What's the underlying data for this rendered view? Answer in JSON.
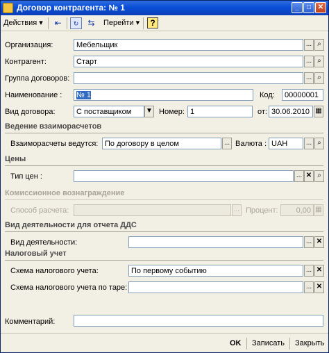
{
  "window": {
    "title": "Договор контрагента: № 1",
    "min": "_",
    "max": "□",
    "close": "✕"
  },
  "toolbar": {
    "actions_label": "Действия",
    "goto_label": "Перейти",
    "help_label": "?"
  },
  "form": {
    "org_label": "Организация:",
    "org_value": "Мебельщик",
    "counterparty_label": "Контрагент:",
    "counterparty_value": "Старт",
    "group_label": "Группа договоров:",
    "group_value": "",
    "name_label": "Наименование :",
    "name_value": "№ 1",
    "code_label": "Код:",
    "code_value": "00000001",
    "type_label": "Вид договора:",
    "type_value": "С поставщиком",
    "number_label": "Номер:",
    "number_value": "1",
    "from_label": "от:",
    "from_value": "30.06.2010"
  },
  "settlements": {
    "section_title": "Ведение взаиморасчетов",
    "mode_label": "Взаиморасчеты ведутся:",
    "mode_value": "По договору в целом",
    "currency_label": "Валюта :",
    "currency_value": "UAH"
  },
  "prices": {
    "section_title": "Цены",
    "type_label": "Тип цен :",
    "type_value": ""
  },
  "commission": {
    "section_title": "Комиссионное вознаграждение",
    "method_label": "Способ расчета:",
    "method_value": "",
    "percent_label": "Процент:",
    "percent_value": "0,00"
  },
  "dds": {
    "section_title": "Вид деятельности для отчета ДДС",
    "activity_label": "Вид деятельности:",
    "activity_value": ""
  },
  "tax": {
    "section_title": "Налоговый учет",
    "scheme_label": "Схема налогового учета:",
    "scheme_value": "По первому событию",
    "tare_label": "Схема налогового учета по таре:",
    "tare_value": ""
  },
  "comment": {
    "label": "Комментарий:",
    "value": ""
  },
  "bottom": {
    "ok": "OK",
    "save": "Записать",
    "close": "Закрыть"
  },
  "glyphs": {
    "ellipsis": "...",
    "search": "🔍",
    "clear": "✕",
    "dropdown": "▼",
    "calendar": "▦",
    "calc": "▦"
  }
}
